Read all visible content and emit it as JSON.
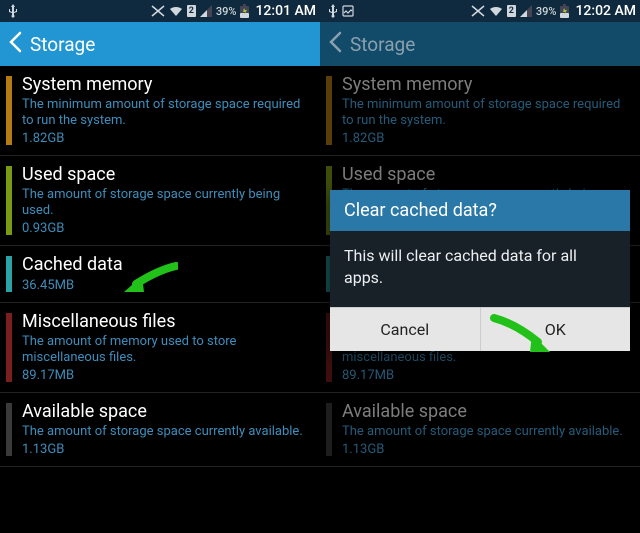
{
  "statusbar": {
    "battery_pct": "39%",
    "time1": "12:01 AM",
    "time2": "12:02 AM"
  },
  "header": {
    "title": "Storage"
  },
  "rows": {
    "system": {
      "title": "System memory",
      "desc": "The minimum amount of storage space required to run the system.",
      "value": "1.82GB",
      "swatch": "#b57a12"
    },
    "used": {
      "title": "Used space",
      "desc": "The amount of storage space currently being used.",
      "value": "0.93GB",
      "swatch": "#7a9a13"
    },
    "cached": {
      "title": "Cached data",
      "desc": "",
      "value": "36.45MB",
      "swatch": "#2aa2a6"
    },
    "misc": {
      "title": "Miscellaneous files",
      "desc": "The amount of memory used to store miscellaneous files.",
      "value": "89.17MB",
      "swatch": "#7a1e1e"
    },
    "available": {
      "title": "Available space",
      "desc": "The amount of storage space currently available.",
      "value": "1.13GB",
      "swatch": "#3a3a3a"
    }
  },
  "dialog": {
    "title": "Clear cached data?",
    "body": "This will clear cached data for all apps.",
    "cancel": "Cancel",
    "ok": "OK"
  }
}
